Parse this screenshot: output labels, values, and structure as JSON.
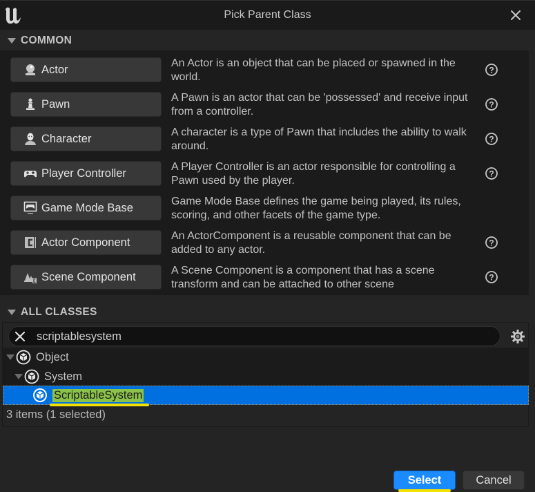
{
  "window": {
    "title": "Pick Parent Class",
    "logo_icon": "unreal-engine-logo-icon",
    "close_icon": "close-icon"
  },
  "common": {
    "header": "COMMON",
    "items": [
      {
        "name": "Actor",
        "icon": "actor-icon",
        "description": "An Actor is an object that can be placed or spawned in the world.",
        "has_help": true
      },
      {
        "name": "Pawn",
        "icon": "pawn-icon",
        "description": "A Pawn is an actor that can be 'possessed' and receive input from a controller.",
        "has_help": true
      },
      {
        "name": "Character",
        "icon": "character-icon",
        "description": "A character is a type of Pawn that includes the ability to walk around.",
        "has_help": true
      },
      {
        "name": "Player Controller",
        "icon": "gamepad-icon",
        "description": "A Player Controller is an actor responsible for controlling a Pawn used by the player.",
        "has_help": true
      },
      {
        "name": "Game Mode Base",
        "icon": "game-mode-icon",
        "description": "Game Mode Base defines the game being played, its rules, scoring, and other facets of the game type.",
        "has_help": false
      },
      {
        "name": "Actor Component",
        "icon": "actor-component-icon",
        "description": "An ActorComponent is a reusable component that can be added to any actor.",
        "has_help": true
      },
      {
        "name": "Scene Component",
        "icon": "scene-component-icon",
        "description": "A Scene Component is a component that has a scene transform and can be attached to other scene",
        "has_help": true
      }
    ]
  },
  "all_classes": {
    "header": "ALL CLASSES",
    "search": {
      "value": "scriptablesystem",
      "placeholder": ""
    },
    "tree": [
      {
        "label": "Object",
        "depth": 0,
        "expanded": true,
        "selected": false
      },
      {
        "label": "System",
        "depth": 1,
        "expanded": true,
        "selected": false
      },
      {
        "label": "ScriptableSystem",
        "depth": 2,
        "expanded": false,
        "selected": true
      }
    ],
    "status": "3 items (1 selected)"
  },
  "footer": {
    "select_label": "Select",
    "cancel_label": "Cancel"
  },
  "colors": {
    "selection": "#0070e0",
    "primary_button": "#1a8cff",
    "highlight": "#8bc34a",
    "annotation": "#f5e000"
  }
}
